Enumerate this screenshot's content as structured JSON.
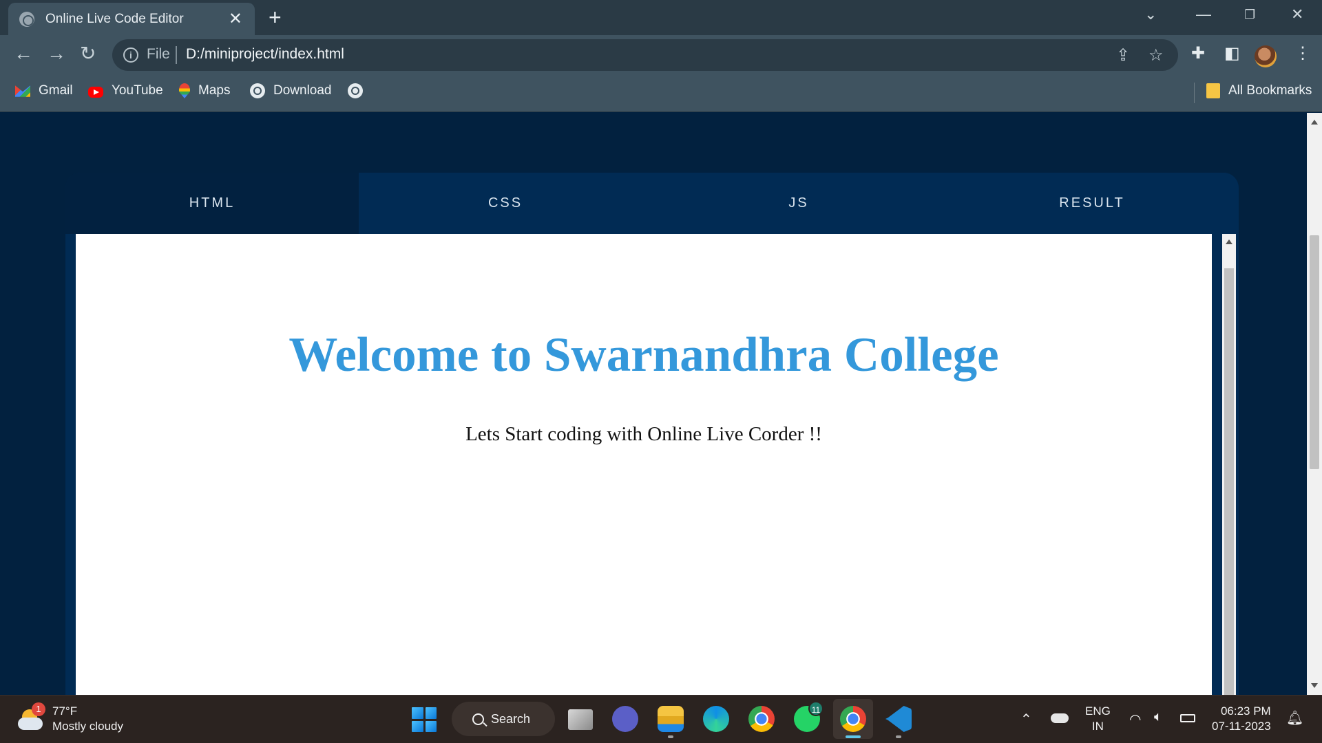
{
  "browser": {
    "tab_title": "Online Live Code Editor",
    "address": {
      "scheme_label": "File",
      "url": "D:/miniproject/index.html"
    },
    "bookmarks": [
      {
        "label": "Gmail",
        "icon": "gmail-icon"
      },
      {
        "label": "YouTube",
        "icon": "youtube-icon"
      },
      {
        "label": "Maps",
        "icon": "maps-icon"
      },
      {
        "label": "Download",
        "icon": "globe-icon"
      },
      {
        "label": "",
        "icon": "globe-icon"
      }
    ],
    "all_bookmarks_label": "All Bookmarks"
  },
  "editor": {
    "tabs": [
      {
        "label": "HTML",
        "active": true
      },
      {
        "label": "CSS",
        "active": false
      },
      {
        "label": "JS",
        "active": false
      },
      {
        "label": "RESULT",
        "active": false
      }
    ],
    "result": {
      "heading": "Welcome to Swarnandhra College",
      "text": "Lets Start coding with Online Live Corder !!"
    }
  },
  "taskbar": {
    "weather": {
      "temperature": "77°F",
      "condition": "Mostly cloudy",
      "badge": "1"
    },
    "search_label": "Search",
    "apps": [
      "file-explorer-icon",
      "teams-icon",
      "folder-icon",
      "edge-icon",
      "chrome-icon",
      "whatsapp-icon",
      "chrome-icon",
      "vscode-icon"
    ],
    "whatsapp_badge": "11",
    "language": {
      "line1": "ENG",
      "line2": "IN"
    },
    "clock": {
      "time": "06:23 PM",
      "date": "07-11-2023"
    }
  },
  "colors": {
    "page_background": "#02213f",
    "editor_tab_bar": "#012b54",
    "active_tab": "#022140",
    "heading_blue": "#3498db"
  }
}
